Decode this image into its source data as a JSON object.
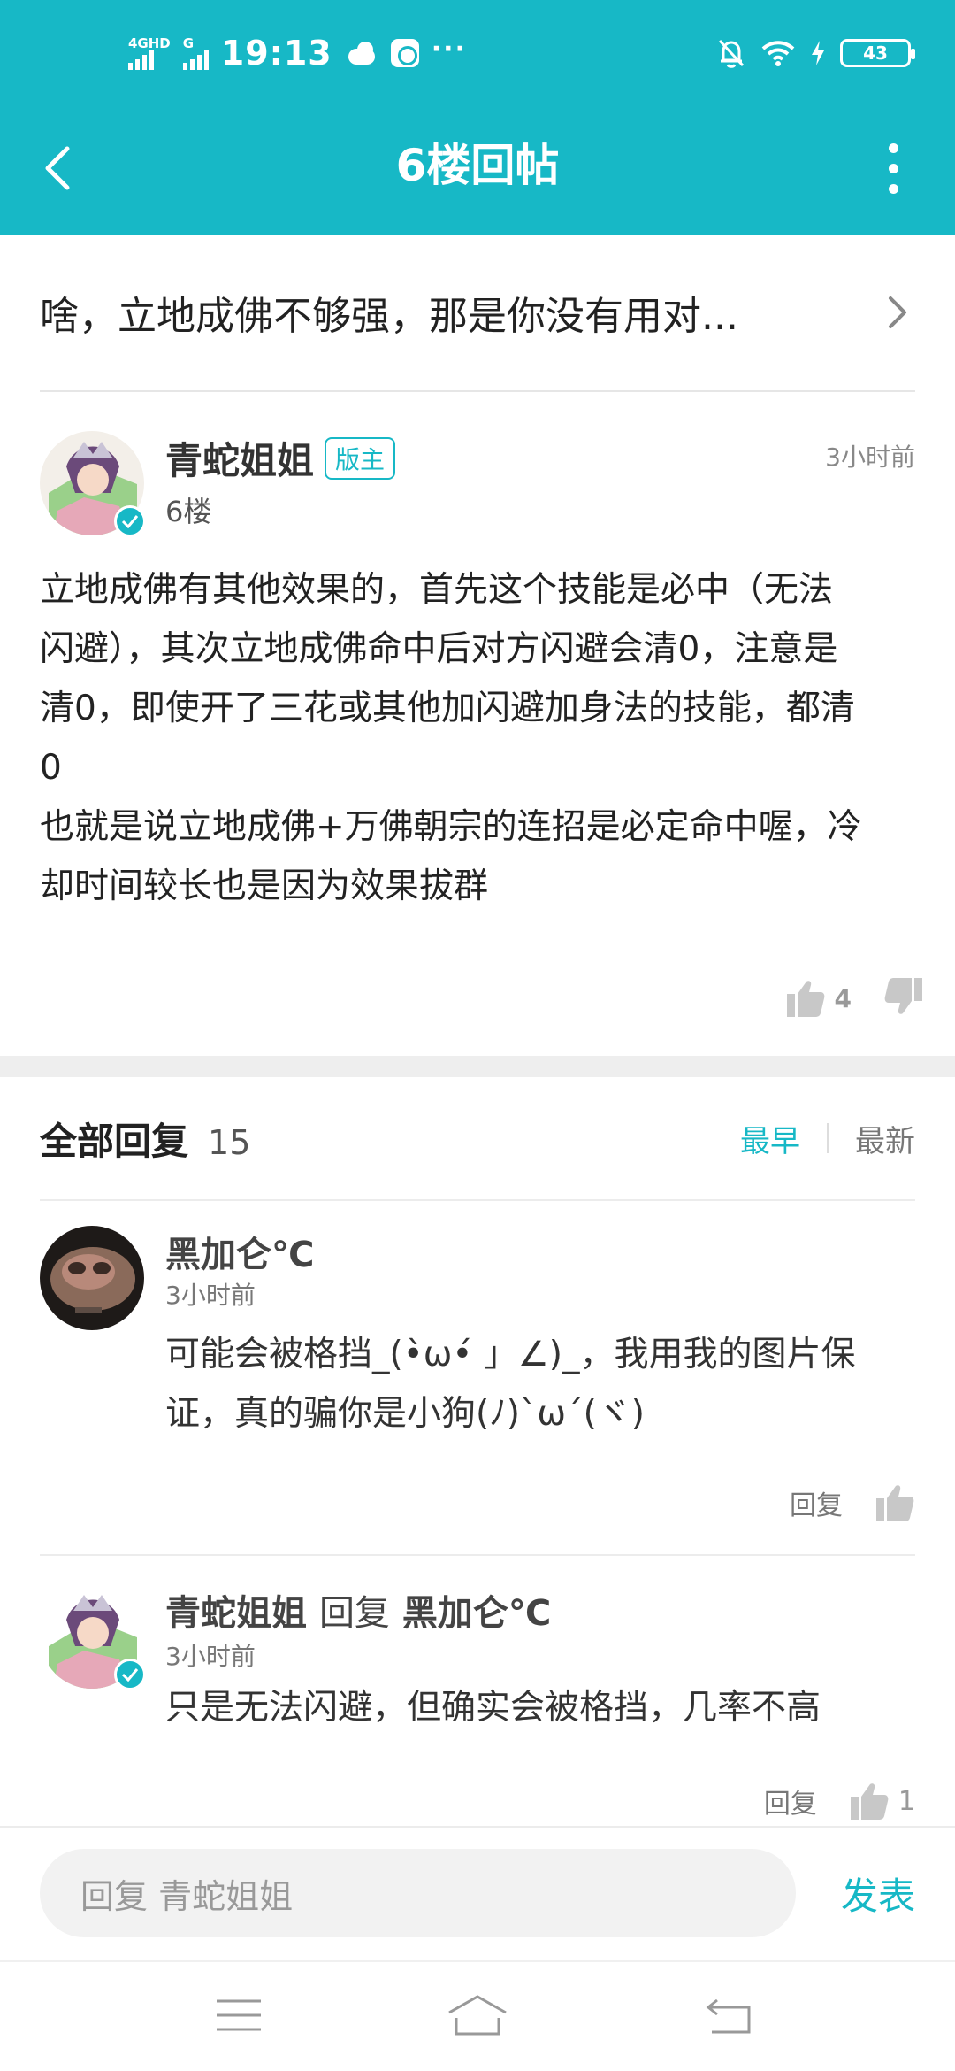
{
  "status_bar": {
    "net1": "4GHD",
    "net2": "G",
    "time": "19:13",
    "battery": "43"
  },
  "header": {
    "title": "6楼回帖"
  },
  "topic": {
    "title": "啥，立地成佛不够强，那是你没有用对..."
  },
  "floor_post": {
    "author": "青蛇姐姐",
    "badge": "版主",
    "floor": "6楼",
    "time": "3小时前",
    "body": "立地成佛有其他效果的，首先这个技能是必中（无法\n闪避），其次立地成佛命中后对方闪避会清0，注意是\n清0，即使开了三花或其他加闪避加身法的技能，都清\n0\n也就是说立地成佛+万佛朝宗的连招是必定命中喔，冷\n却时间较长也是因为效果拔群",
    "likes": "4"
  },
  "replies_header": {
    "title": "全部回复",
    "count": "15",
    "sort_earliest": "最早",
    "sort_newest": "最新"
  },
  "replies": [
    {
      "author": "黑加仑℃",
      "time": "3小时前",
      "text": "可能会被格挡_(•̀ω•́ 」∠)_，我用我的图片保\n证，真的骗你是小狗(ﾉ)`ω´(ヾ)",
      "reply_label": "回复",
      "likes": ""
    },
    {
      "author": "青蛇姐姐",
      "reply_word": "回复",
      "reply_to": "黑加仑℃",
      "time": "3小时前",
      "text": "只是无法闪避，但确实会被格挡，几率不高",
      "reply_label": "回复",
      "likes": "1"
    }
  ],
  "input_bar": {
    "placeholder": "回复 青蛇姐姐",
    "send": "发表"
  },
  "colors": {
    "accent": "#17b8c6"
  }
}
